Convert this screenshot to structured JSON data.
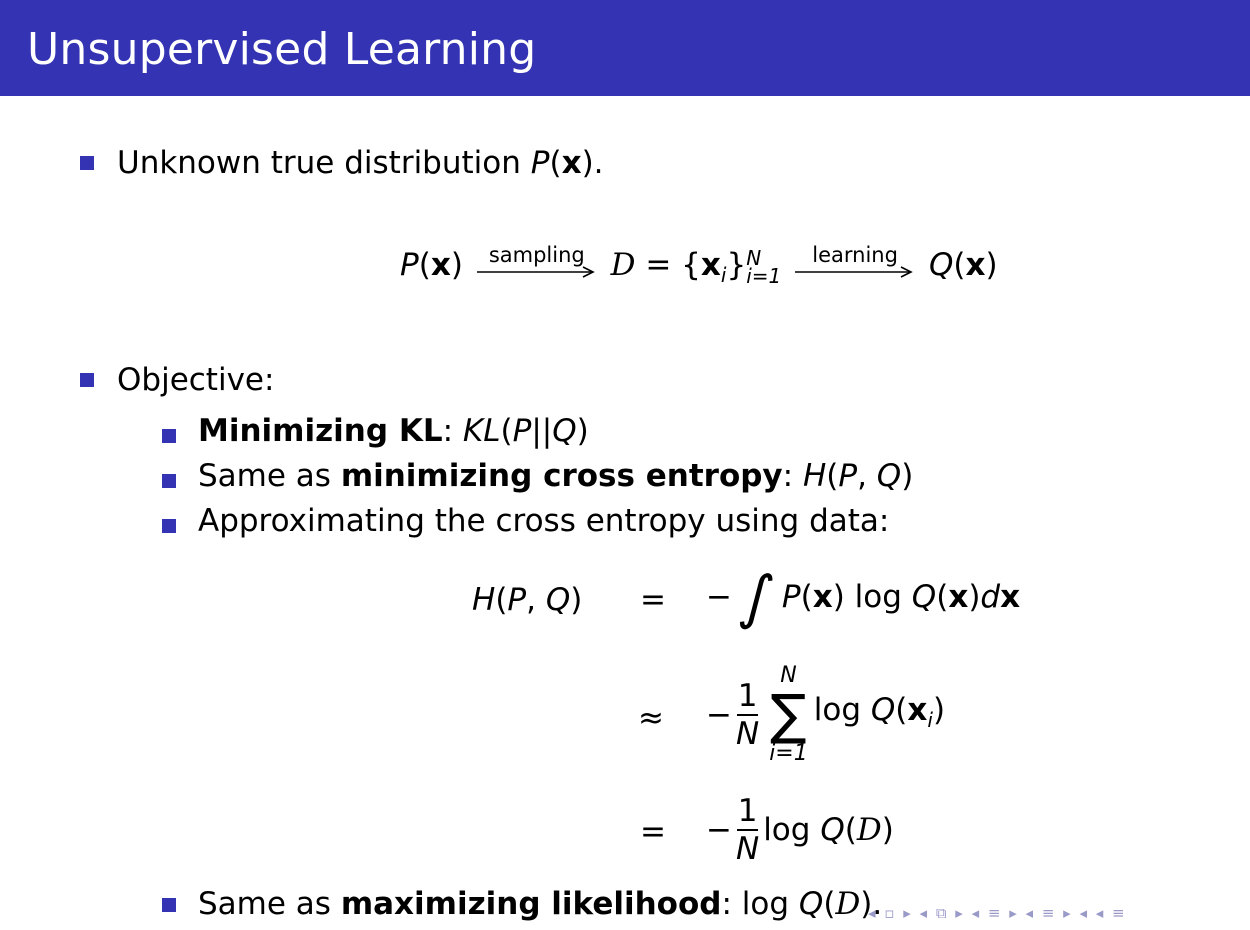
{
  "slide": {
    "title": "Unsupervised Learning",
    "bullet1": {
      "text": "Unknown true distribution ",
      "math": "P(x)."
    },
    "pipeline": {
      "left": "P(x)",
      "arrow1_label": "sampling",
      "middle": "D = {x_i}_{i=1}^N",
      "arrow2_label": "learning",
      "right": "Q(x)"
    },
    "bullet2": {
      "text": "Objective:"
    },
    "sub1": {
      "bold": "Minimizing KL",
      "rest": ": ",
      "math": "KL(P||Q)"
    },
    "sub2": {
      "prefix": "Same as ",
      "bold": "minimizing cross entropy",
      "rest": ": ",
      "math": "H(P, Q)"
    },
    "sub3": {
      "text": "Approximating the cross entropy using data:"
    },
    "equations": {
      "lhs": "H(P, Q)",
      "rel1": "=",
      "rhs1": "− ∫ P(x) log Q(x)dx",
      "rel2": "≈",
      "rhs2": "− (1/N) Σ_{i=1}^{N} log Q(x_i)",
      "rel3": "=",
      "rhs3": "− (1/N) log Q(D)"
    },
    "sub4": {
      "prefix": "Same as ",
      "bold": "maximizing likelihood",
      "rest": ": ",
      "math": "log Q(D)."
    }
  },
  "nav_controls": "◂ ▫ ▸ ◂ ⧉ ▸ ◂ ≡ ▸ ◂ ≡ ▸ ◂ ◂ ≡",
  "colors": {
    "accent": "#3333b3",
    "nav": "#9a9ac8"
  }
}
